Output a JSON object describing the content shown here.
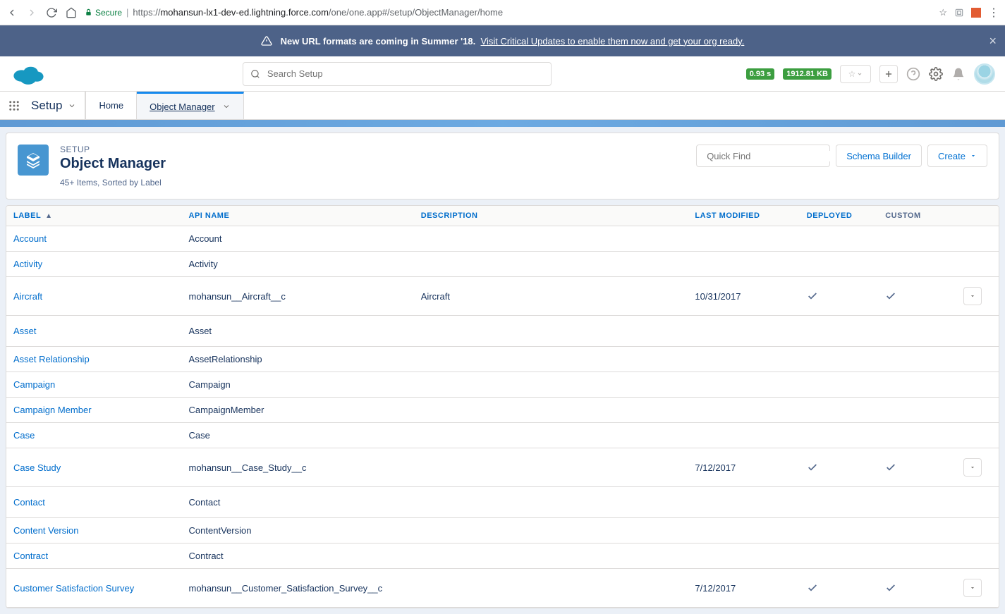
{
  "browser": {
    "secure_label": "Secure",
    "url_prefix": "https://",
    "url_host": "mohansun-lx1-dev-ed.lightning.force.com",
    "url_path": "/one/one.app#/setup/ObjectManager/home"
  },
  "banner": {
    "message": "New URL formats are coming in Summer '18.",
    "link_text": "Visit Critical Updates to enable them now and get your org ready."
  },
  "header": {
    "search_placeholder": "Search Setup",
    "perf_time": "0.93 s",
    "perf_size": "1912.81 KB"
  },
  "context": {
    "app_name": "Setup",
    "nav_home": "Home",
    "nav_obj": "Object Manager"
  },
  "page": {
    "eyebrow": "SETUP",
    "title": "Object Manager",
    "meta": "45+ Items, Sorted by Label",
    "quick_find_placeholder": "Quick Find",
    "schema_builder": "Schema Builder",
    "create": "Create"
  },
  "columns": {
    "label": "LABEL",
    "api": "API NAME",
    "desc": "DESCRIPTION",
    "mod": "LAST MODIFIED",
    "dep": "DEPLOYED",
    "cust": "CUSTOM"
  },
  "rows": [
    {
      "label": "Account",
      "api": "Account",
      "desc": "",
      "mod": "",
      "dep": false,
      "cust": false,
      "act": false,
      "tall": false
    },
    {
      "label": "Activity",
      "api": "Activity",
      "desc": "",
      "mod": "",
      "dep": false,
      "cust": false,
      "act": false,
      "tall": false
    },
    {
      "label": "Aircraft",
      "api": "mohansun__Aircraft__c",
      "desc": "Aircraft",
      "mod": "10/31/2017",
      "dep": true,
      "cust": true,
      "act": true,
      "tall": true
    },
    {
      "label": "Asset",
      "api": "Asset",
      "desc": "",
      "mod": "",
      "dep": false,
      "cust": false,
      "act": false,
      "tall": true
    },
    {
      "label": "Asset Relationship",
      "api": "AssetRelationship",
      "desc": "",
      "mod": "",
      "dep": false,
      "cust": false,
      "act": false,
      "tall": false
    },
    {
      "label": "Campaign",
      "api": "Campaign",
      "desc": "",
      "mod": "",
      "dep": false,
      "cust": false,
      "act": false,
      "tall": false
    },
    {
      "label": "Campaign Member",
      "api": "CampaignMember",
      "desc": "",
      "mod": "",
      "dep": false,
      "cust": false,
      "act": false,
      "tall": false
    },
    {
      "label": "Case",
      "api": "Case",
      "desc": "",
      "mod": "",
      "dep": false,
      "cust": false,
      "act": false,
      "tall": false
    },
    {
      "label": "Case Study",
      "api": "mohansun__Case_Study__c",
      "desc": "",
      "mod": "7/12/2017",
      "dep": true,
      "cust": true,
      "act": true,
      "tall": true
    },
    {
      "label": "Contact",
      "api": "Contact",
      "desc": "",
      "mod": "",
      "dep": false,
      "cust": false,
      "act": false,
      "tall": true
    },
    {
      "label": "Content Version",
      "api": "ContentVersion",
      "desc": "",
      "mod": "",
      "dep": false,
      "cust": false,
      "act": false,
      "tall": false
    },
    {
      "label": "Contract",
      "api": "Contract",
      "desc": "",
      "mod": "",
      "dep": false,
      "cust": false,
      "act": false,
      "tall": false
    },
    {
      "label": "Customer Satisfaction Survey",
      "api": "mohansun__Customer_Satisfaction_Survey__c",
      "desc": "",
      "mod": "7/12/2017",
      "dep": true,
      "cust": true,
      "act": true,
      "tall": true
    }
  ]
}
